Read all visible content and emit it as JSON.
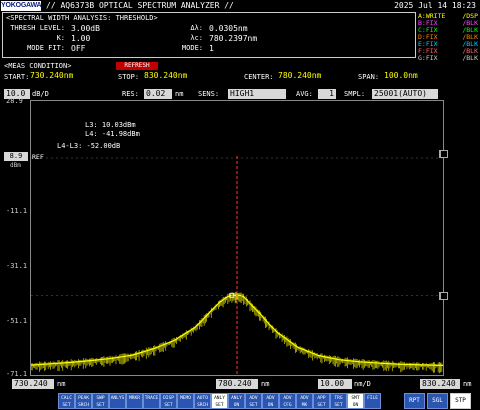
{
  "header": {
    "brand": "YOKOGAWA",
    "title": "// AQ6373B OPTICAL SPECTRUM ANALYZER //",
    "datetime": "2025 Jul 14 18:23"
  },
  "analysis": {
    "heading": "<SPECTRAL WIDTH ANALYSIS: THRESHOLD>",
    "thresh_level_label": "THRESH LEVEL:",
    "thresh_level_value": "3.00dB",
    "k_label": "K:",
    "k_value": "1.00",
    "mode_fit_label": "MODE FIT:",
    "mode_fit_value": "OFF",
    "dl_label": "Δλ:",
    "dl_value": "0.0305nm",
    "lc_label": "λc:",
    "lc_value": "780.2397nm",
    "mode_label": "MODE:",
    "mode_value": "1"
  },
  "traces": [
    {
      "left": "A:WRITE",
      "right": "/DSP"
    },
    {
      "left": "B:FIX",
      "right": "/BLK"
    },
    {
      "left": "C:FIX",
      "right": "/BLK"
    },
    {
      "left": "D:FIX",
      "right": "/BLK"
    },
    {
      "left": "E:FIX",
      "right": "/BLK"
    },
    {
      "left": "F:FIX",
      "right": "/BLK"
    },
    {
      "left": "G:FIX",
      "right": "/BLK"
    }
  ],
  "meas": {
    "label": "<MEAS CONDITION>",
    "badge": "REFRESH",
    "start_label": "START:",
    "start_value": "730.240nm",
    "stop_label": "STOP:",
    "stop_value": "830.240nm",
    "center_label": "CENTER:",
    "center_value": "780.240nm",
    "span_label": "SPAN:",
    "span_value": "100.0nm"
  },
  "settings": {
    "scale_value": "10.0",
    "scale_unit": "dB/D",
    "res_label": "RES:",
    "res_value": "0.02",
    "res_unit": "nm",
    "sens_label": "SENS:",
    "sens_value": "HIGH1",
    "avg_label": "AVG:",
    "avg_value": "1",
    "smpl_label": "SMPL:",
    "smpl_value": "25001(AUTO)"
  },
  "plot": {
    "y_labels": [
      "28.9",
      "-11.1",
      "-31.1",
      "-51.1",
      "-71.1"
    ],
    "ref_value": "8.9",
    "ref_label": "REF",
    "ref_unit": "dBm",
    "markers": [
      "L3:  10.03dBm",
      "L4: -41.98dBm",
      "L4-L3: -52.00dB"
    ]
  },
  "axis": {
    "start": "730.240",
    "start_unit": "nm",
    "center": "780.240",
    "center_unit": "nm",
    "span_div": "10.00",
    "span_div_unit": "nm/D",
    "stop": "830.240",
    "stop_unit": "nm"
  },
  "buttons": {
    "function": [
      "CALC SET",
      "PEAK SRCH",
      "SWP SET",
      "ANLYS",
      "MRKR",
      "TRACE",
      "DISP SET",
      "MEMO",
      "AUTO SRCH",
      "ANLY SET",
      "ANLY ON",
      "ADV SET",
      "ADV ON",
      "ADV CFG",
      "ADV MK",
      "APP SET",
      "TRG SET",
      "SMT ON",
      "FILE"
    ],
    "mode": [
      "RPT",
      "SGL",
      "STP"
    ]
  },
  "chart_data": {
    "type": "line",
    "title": "",
    "xlabel": "",
    "ylabel": "",
    "x_unit": "nm",
    "y_unit": "dBm",
    "xlim": [
      730.24,
      830.24
    ],
    "ylim": [
      -71.1,
      28.9
    ],
    "grid": false,
    "center_marker_x": 780.24,
    "series": [
      {
        "color": "#ffff00",
        "x": [
          730.24,
          735,
          740,
          745,
          750,
          755,
          760,
          765,
          770,
          772,
          774,
          776,
          778,
          779,
          779.8,
          780.24,
          780.7,
          781.5,
          782.5,
          784,
          786,
          788,
          790,
          795,
          800,
          805,
          810,
          815,
          820,
          825,
          830.24
        ],
        "y": [
          -67.5,
          -67.0,
          -66.5,
          -65.8,
          -65.0,
          -63.8,
          -61.5,
          -58.5,
          -53.8,
          -50.8,
          -47.6,
          -44.6,
          -42.5,
          -42.0,
          -42.0,
          -42.0,
          -42.0,
          -42.2,
          -43.5,
          -46.0,
          -49.0,
          -52.5,
          -55.5,
          -61.0,
          -64.0,
          -65.5,
          -66.3,
          -66.8,
          -67.2,
          -67.4,
          -67.6
        ]
      }
    ]
  },
  "colors": {
    "trace": "#ffff00",
    "center_line": "#ff3030",
    "button": "#2a55b0"
  }
}
